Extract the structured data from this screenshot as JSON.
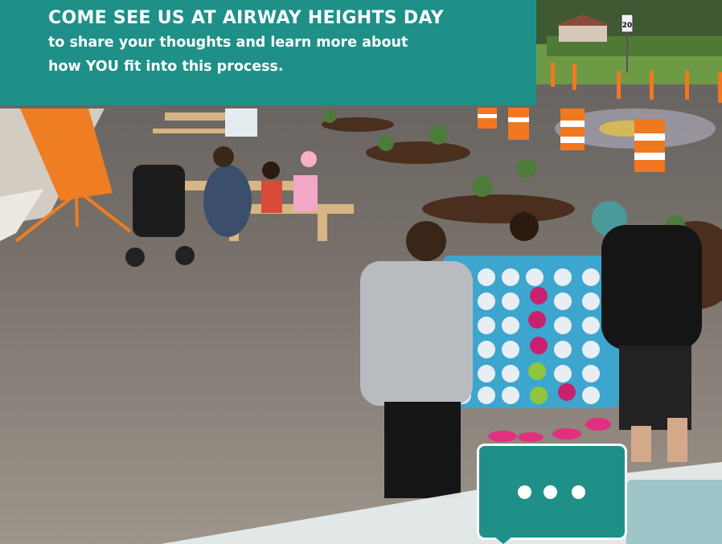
{
  "banner": {
    "title": "COME SEE US AT AIRWAY HEIGHTS DAY",
    "subtitle_line1": "to share your thoughts and learn more about",
    "subtitle_line2": "how YOU fit into this process."
  },
  "photo": {
    "road_sign_text": "20"
  },
  "icons": {
    "chat_bubble": "speech-bubble-ellipsis-icon"
  },
  "colors": {
    "accent_teal": "#1e9088",
    "light_teal": "#9ec5c8",
    "text_white": "#ffffff"
  }
}
